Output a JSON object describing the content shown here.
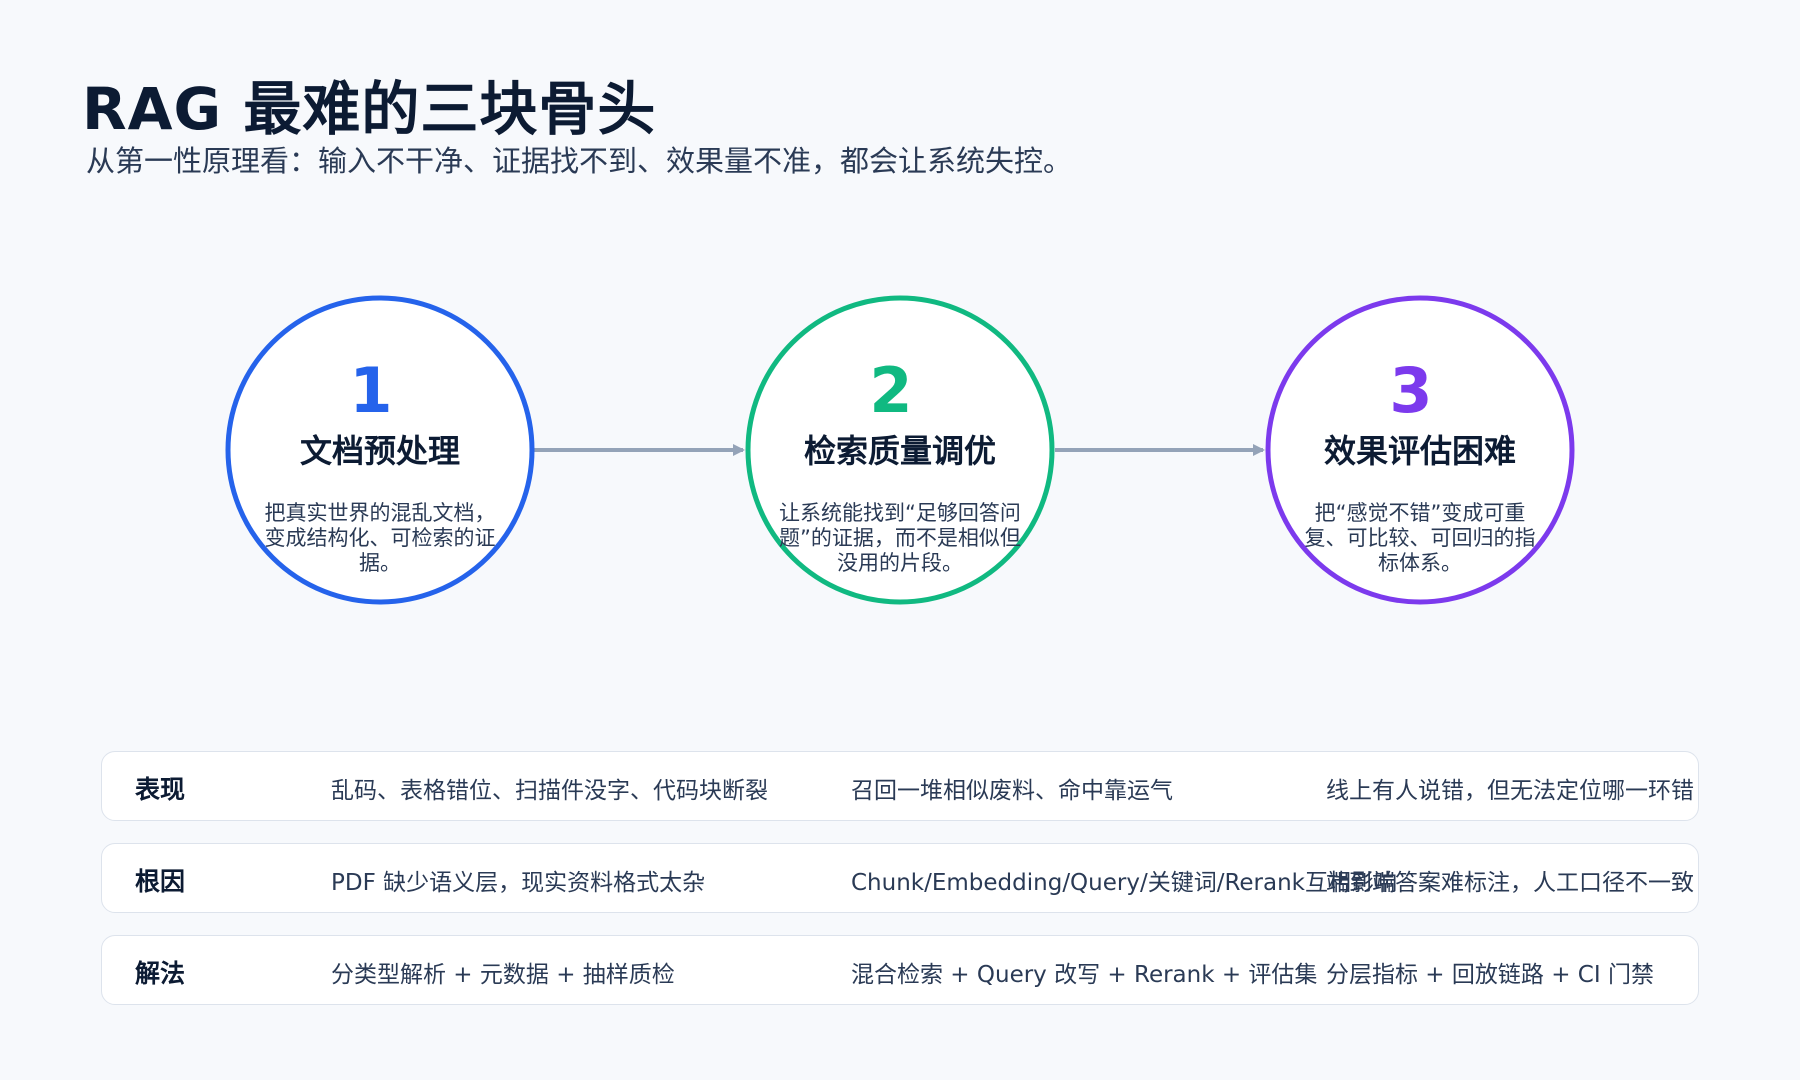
{
  "header": {
    "title": "RAG 最难的三块骨头",
    "subtitle": "从第一性原理看：输入不干净、证据找不到、效果量不准，都会让系统失控。"
  },
  "colors": {
    "blue": "#2563eb",
    "green": "#10b981",
    "purple": "#7c3aed",
    "arrow": "#94a3b8"
  },
  "nodes": [
    {
      "number": "1",
      "title": "文档预处理",
      "description": "把真实世界的混乱文档，变成结构化、可检索的证据。",
      "color": "#2563eb"
    },
    {
      "number": "2",
      "title": "检索质量调优",
      "description": "让系统能找到“足够回答问题”的证据，而不是相似但没用的片段。",
      "color": "#10b981"
    },
    {
      "number": "3",
      "title": "效果评估困难",
      "description": "把“感觉不错”变成可重复、可比较、可回归的指标体系。",
      "color": "#7c3aed"
    }
  ],
  "table": {
    "rows": [
      {
        "label": "表现",
        "cells": [
          "乱码、表格错位、扫描件没字、代码块断裂",
          "召回一堆相似废料、命中靠运气",
          "线上有人说错，但无法定位哪一环错"
        ]
      },
      {
        "label": "根因",
        "cells": [
          "PDF 缺少语义层，现实资料格式太杂",
          "Chunk/Embedding/Query/关键词/Rerank互相影响",
          "端到端答案难标注，人工口径不一致"
        ]
      },
      {
        "label": "解法",
        "cells": [
          "分类型解析 + 元数据 + 抽样质检",
          "混合检索 + Query 改写 + Rerank + 评估集",
          "分层指标 + 回放链路 + CI 门禁"
        ]
      }
    ]
  }
}
